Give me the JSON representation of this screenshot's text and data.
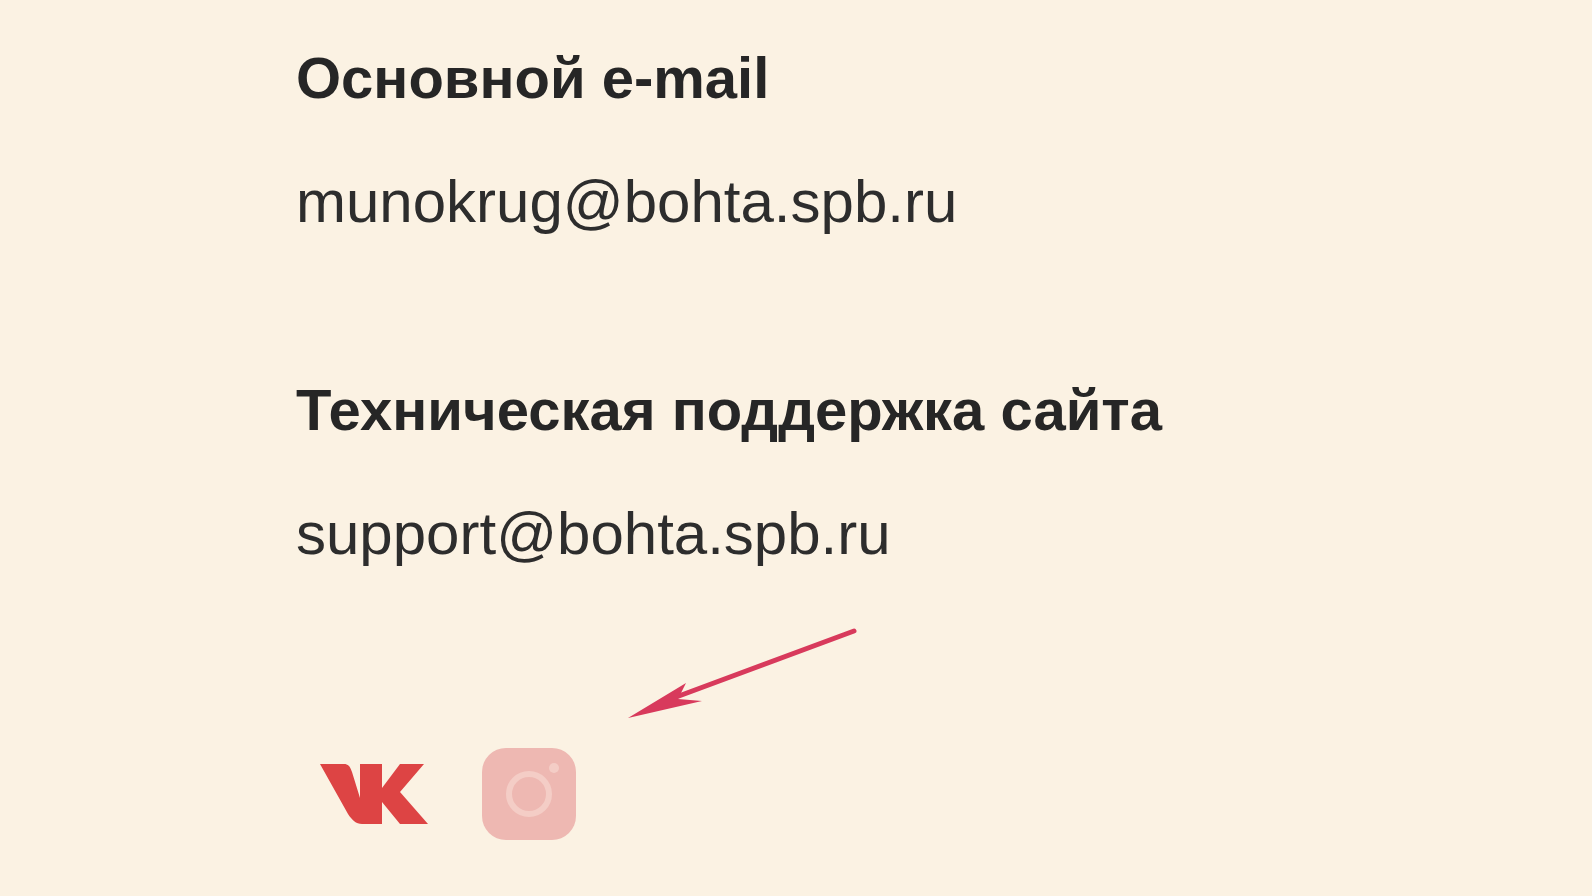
{
  "contacts": [
    {
      "title": "Основной e-mail",
      "email": "munokrug@bohta.spb.ru"
    },
    {
      "title": "Техническая поддержка сайта",
      "email": "support@bohta.spb.ru"
    }
  ],
  "social": [
    {
      "kind": "vk"
    },
    {
      "kind": "camera"
    }
  ],
  "annotation": {
    "kind": "arrow"
  }
}
